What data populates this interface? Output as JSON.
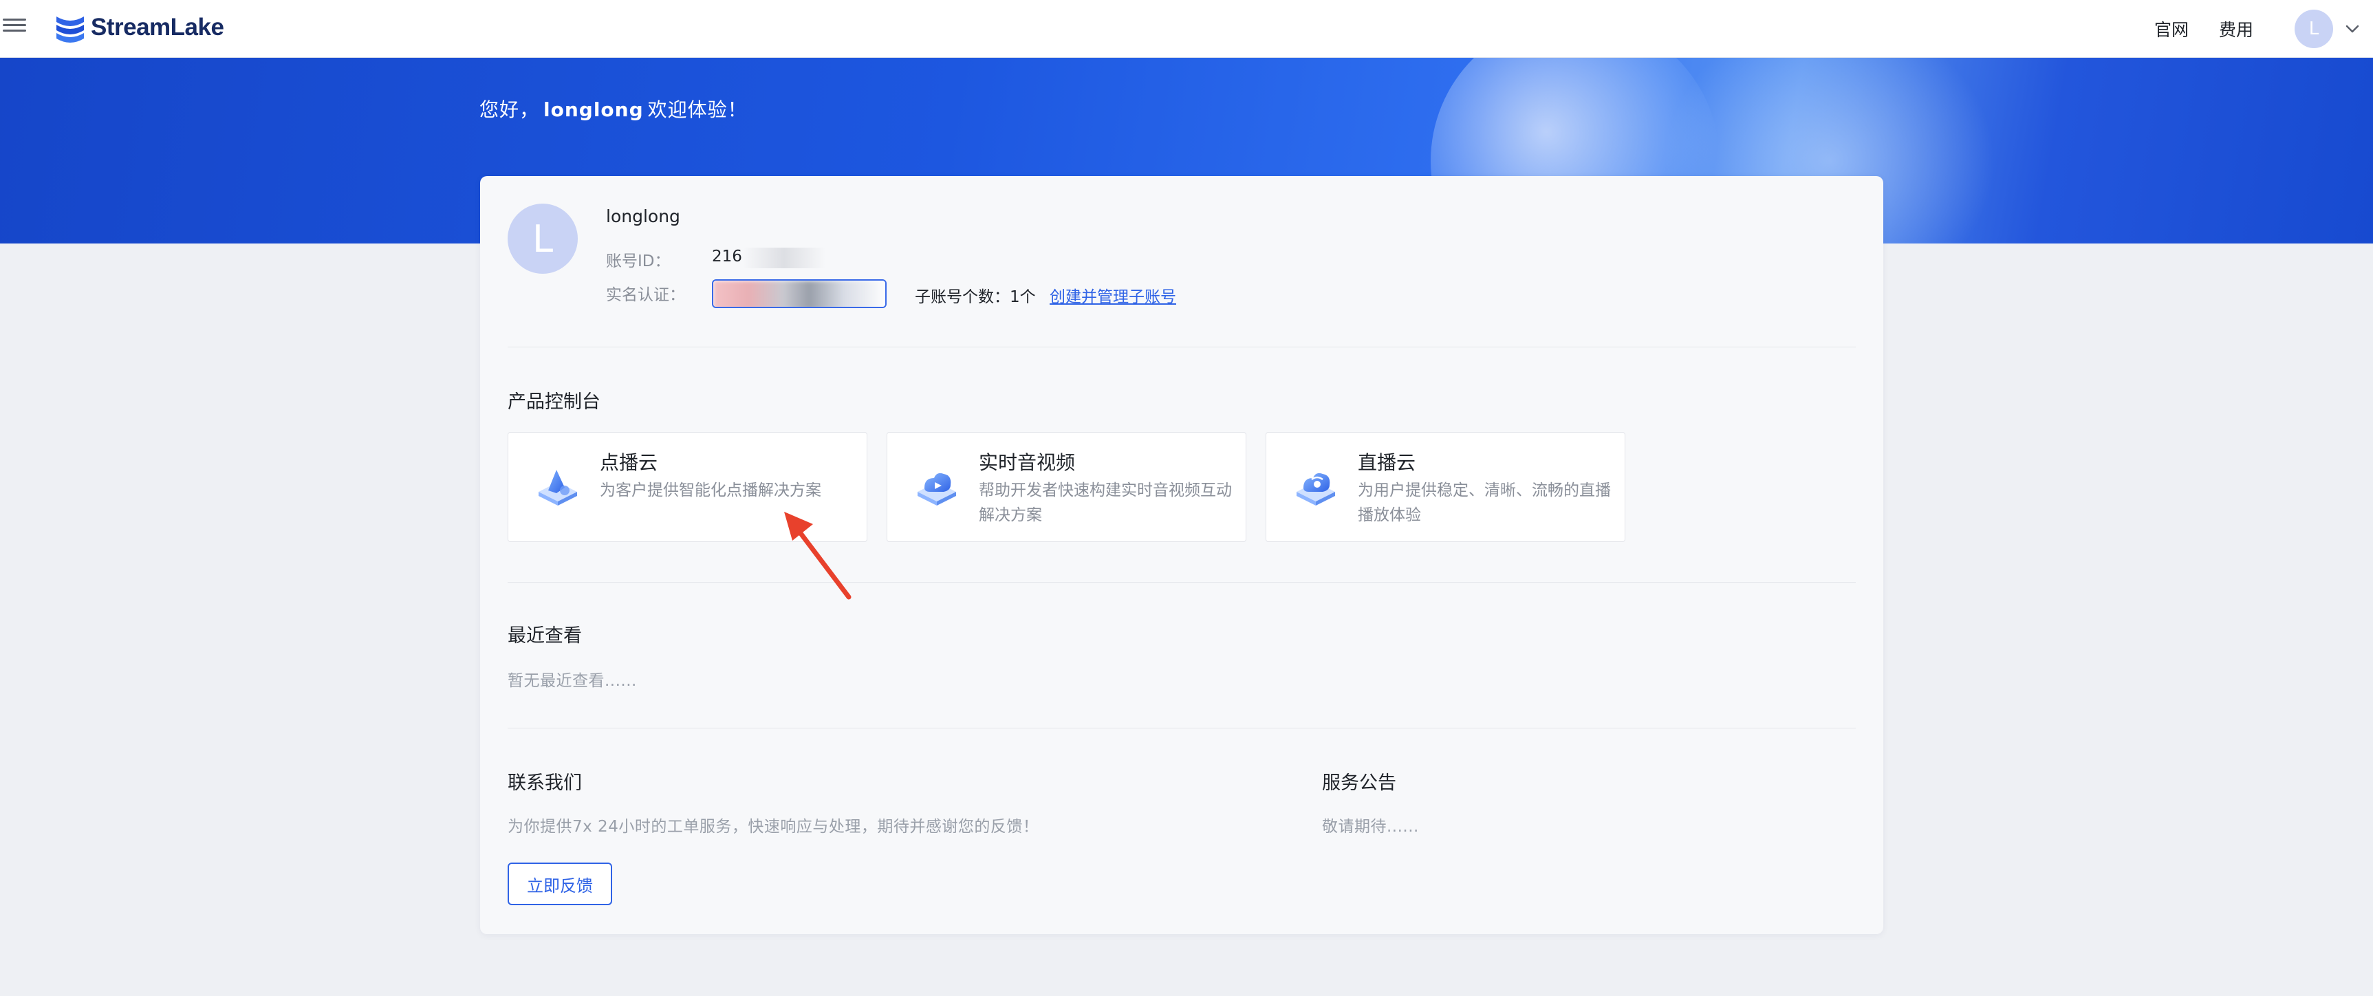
{
  "nav": {
    "logo_text": "StreamLake",
    "links": [
      "官网",
      "费用"
    ],
    "avatar_letter": "L"
  },
  "banner": {
    "greeting_prefix": "您好，",
    "greeting_name": "longlong",
    "greeting_suffix": "欢迎体验！"
  },
  "account": {
    "avatar_letter": "L",
    "username": "longlong",
    "id_label": "账号ID：",
    "id_value": "216",
    "realname_label": "实名认证：",
    "subaccount_text": "子账号个数：1个",
    "subaccount_link": "创建并管理子账号"
  },
  "products": {
    "title": "产品控制台",
    "items": [
      {
        "name": "点播云",
        "desc": "为客户提供智能化点播解决方案",
        "icon": "vod-cloud-icon"
      },
      {
        "name": "实时音视频",
        "desc": "帮助开发者快速构建实时音视频互动解决方案",
        "icon": "rtc-cloud-icon"
      },
      {
        "name": "直播云",
        "desc": "为用户提供稳定、清晰、流畅的直播播放体验",
        "icon": "live-cloud-icon"
      }
    ]
  },
  "recent": {
    "title": "最近查看",
    "empty_text": "暂无最近查看......"
  },
  "contact": {
    "title": "联系我们",
    "desc": "为你提供7x 24小时的工单服务，快速响应与处理，期待并感谢您的反馈！",
    "button": "立即反馈"
  },
  "notice": {
    "title": "服务公告",
    "text": "敬请期待......"
  },
  "colors": {
    "brand_blue": "#2f63e6",
    "banner_blue": "#1d57e0",
    "arrow_red": "#e8412c"
  }
}
